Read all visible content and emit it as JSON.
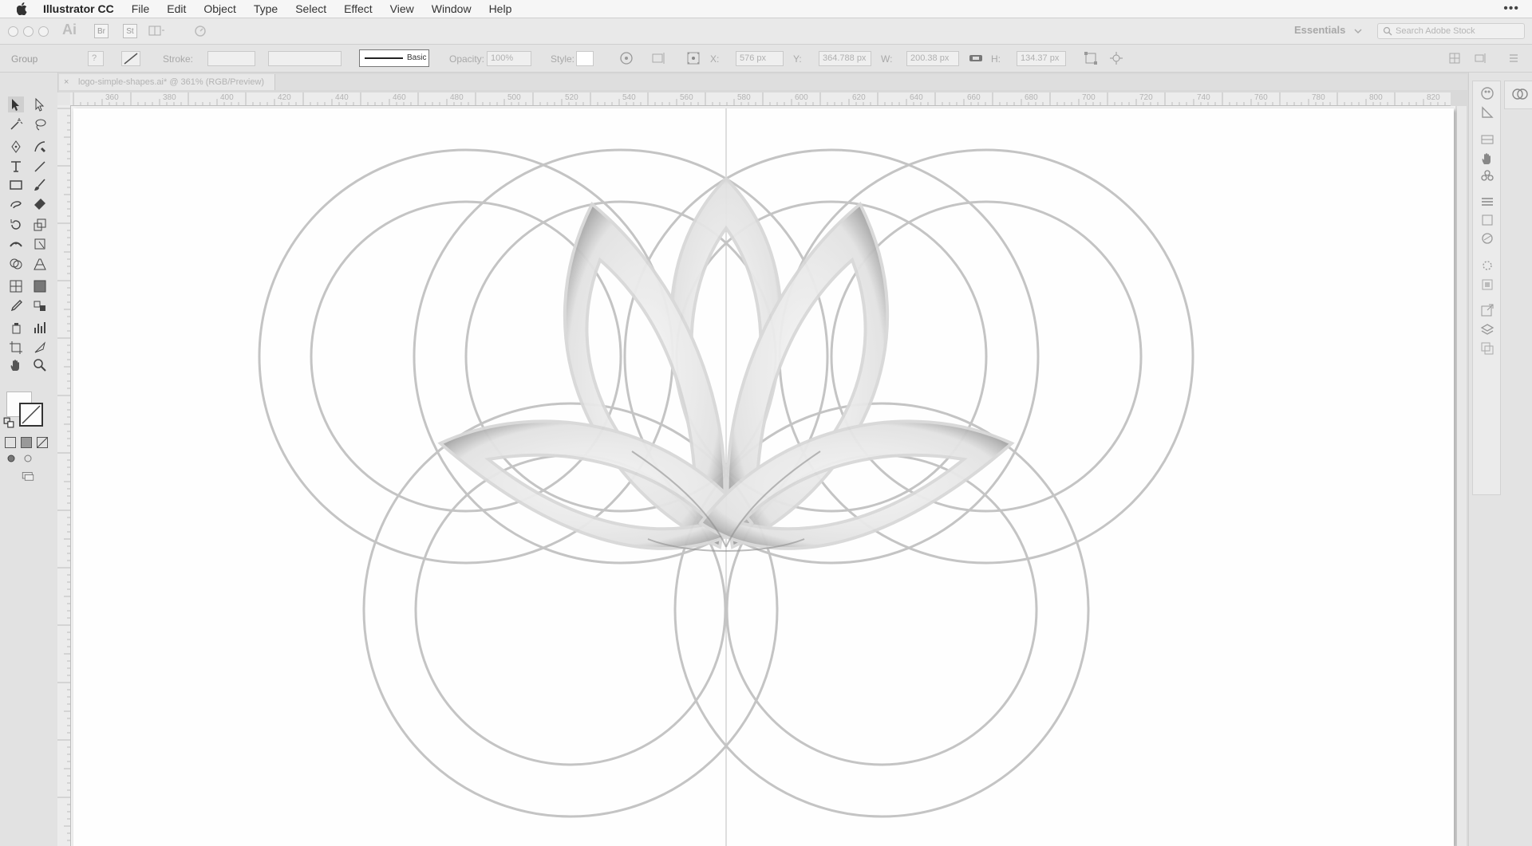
{
  "menubar": {
    "app_name": "Illustrator CC",
    "items": [
      "File",
      "Edit",
      "Object",
      "Type",
      "Select",
      "Effect",
      "View",
      "Window",
      "Help"
    ],
    "more": "•••"
  },
  "appbar": {
    "logo": "Ai",
    "bridge": "Br",
    "stock": "St",
    "workspace": "Essentials",
    "search_placeholder": "Search Adobe Stock"
  },
  "control": {
    "selection_label": "Group",
    "stroke_label": "Stroke:",
    "stroke_profile": "Basic",
    "opacity_label": "Opacity:",
    "opacity_value": "100%",
    "style_label": "Style:",
    "x_label": "X:",
    "x_value": "576 px",
    "y_label": "Y:",
    "y_value": "364.788 px",
    "w_label": "W:",
    "w_value": "200.38 px",
    "h_label": "H:",
    "h_value": "134.37 px"
  },
  "document": {
    "tab_title": "logo-simple-shapes.ai* @ 361% (RGB/Preview)",
    "close": "×"
  },
  "ruler": {
    "top_ticks": [
      "360",
      "380",
      "400",
      "420",
      "440",
      "460",
      "480",
      "500",
      "520",
      "540",
      "560",
      "580",
      "600",
      "620",
      "640",
      "660",
      "680",
      "700",
      "720",
      "740",
      "760",
      "780",
      "800",
      "820"
    ]
  },
  "icons": {
    "tools": [
      "selection-tool",
      "direct-selection-tool",
      "magic-wand-tool",
      "lasso-tool",
      "pen-tool",
      "curvature-tool",
      "type-tool",
      "line-tool",
      "rectangle-tool",
      "paintbrush-tool",
      "shaper-tool",
      "eraser-tool",
      "rotate-tool",
      "scale-tool",
      "width-tool",
      "free-transform-tool",
      "shape-builder-tool",
      "perspective-grid-tool",
      "mesh-tool",
      "gradient-tool",
      "eyedropper-tool",
      "blend-tool",
      "symbol-sprayer-tool",
      "column-graph-tool",
      "artboard-tool",
      "slice-tool",
      "hand-tool",
      "zoom-tool"
    ],
    "dock": [
      "color-icon",
      "color-guide-icon",
      "swatches-icon",
      "brushes-icon",
      "symbols-icon",
      "stroke-icon",
      "gradient-icon",
      "transparency-icon",
      "appearance-icon",
      "graphic-styles-icon",
      "layers-icon",
      "artboards-icon",
      "asset-export-icon",
      "libraries-icon"
    ]
  }
}
